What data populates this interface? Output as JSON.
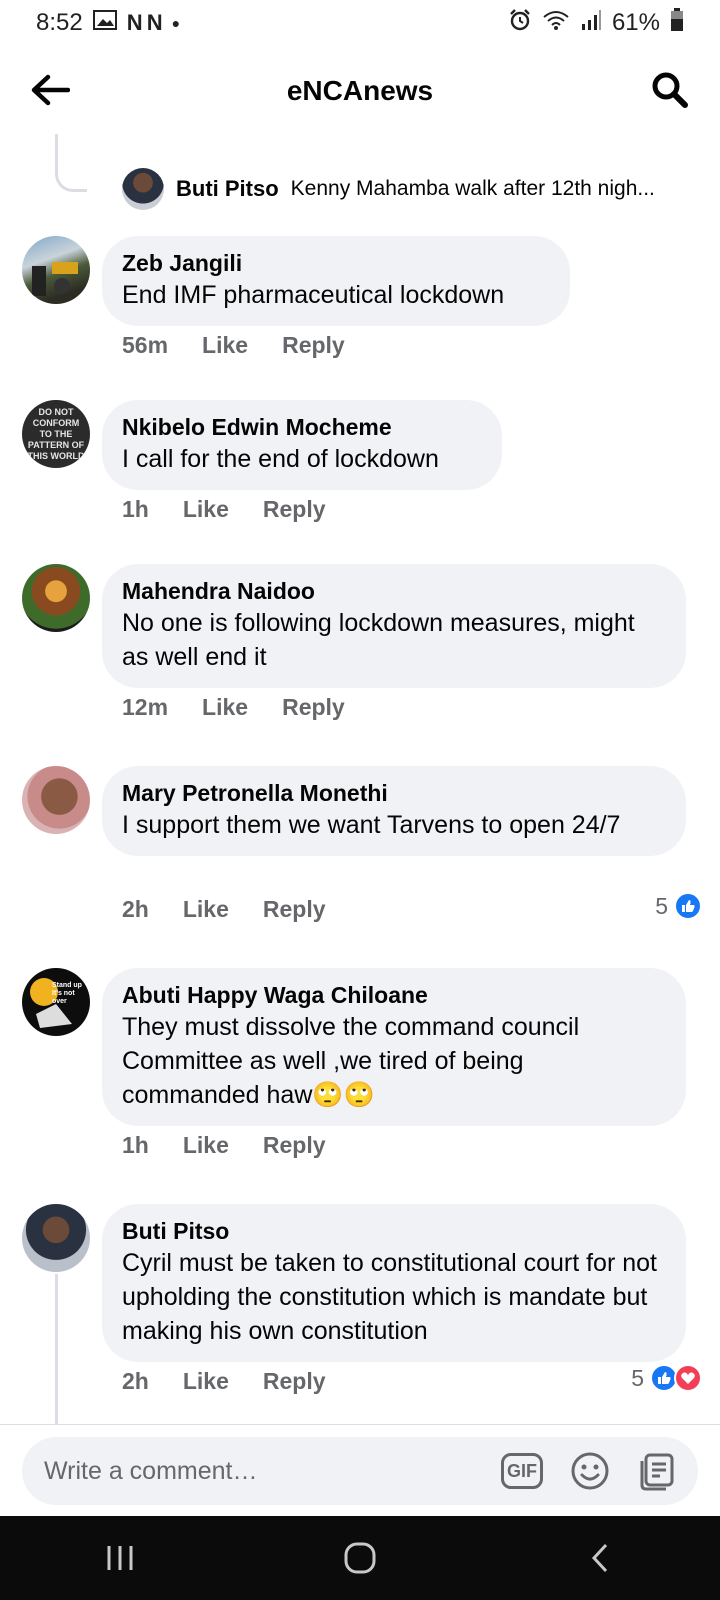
{
  "status_bar": {
    "time": "8:52",
    "battery": "61%",
    "notif_icons": "N N"
  },
  "header": {
    "title": "eNCAnews"
  },
  "partial_reply": {
    "name": "Buti Pitso",
    "text": "Kenny Mahamba walk after 12th nigh..."
  },
  "comments": [
    {
      "name": "Zeb Jangili",
      "text": "End IMF pharmaceutical lockdown",
      "time": "56m",
      "like": "Like",
      "reply": "Reply"
    },
    {
      "name": "Nkibelo Edwin Mocheme",
      "text": "I call for the end of lockdown",
      "time": "1h",
      "like": "Like",
      "reply": "Reply",
      "avatar_text": "DO NOT CONFORM TO THE PATTERN OF THIS WORLD"
    },
    {
      "name": "Mahendra Naidoo",
      "text": "No one is following lockdown measures, might as well end it",
      "time": "12m",
      "like": "Like",
      "reply": "Reply"
    },
    {
      "name": "Mary Petronella Monethi",
      "text": "I support them we want Tarvens to open 24/7",
      "time": "2h",
      "like": "Like",
      "reply": "Reply",
      "reaction_count": "5"
    },
    {
      "name": "Abuti Happy Waga Chiloane",
      "text": "They must dissolve the command council Committee as well ,we tired of being commanded haw🙄🙄",
      "time": "1h",
      "like": "Like",
      "reply": "Reply",
      "avatar_text": "Stand up It's not over"
    },
    {
      "name": "Buti Pitso",
      "text": "Cyril must be taken to constitutional  court for not upholding the constitution  which is mandate but making his own constitution",
      "time": "2h",
      "like": "Like",
      "reply": "Reply",
      "reaction_count": "5"
    }
  ],
  "composer": {
    "placeholder": "Write a comment…",
    "gif_label": "GIF"
  },
  "colors": {
    "bubble": "#f0f2f5",
    "meta": "#65676b",
    "like_blue": "#1877f2",
    "love_red": "#f33e58"
  }
}
